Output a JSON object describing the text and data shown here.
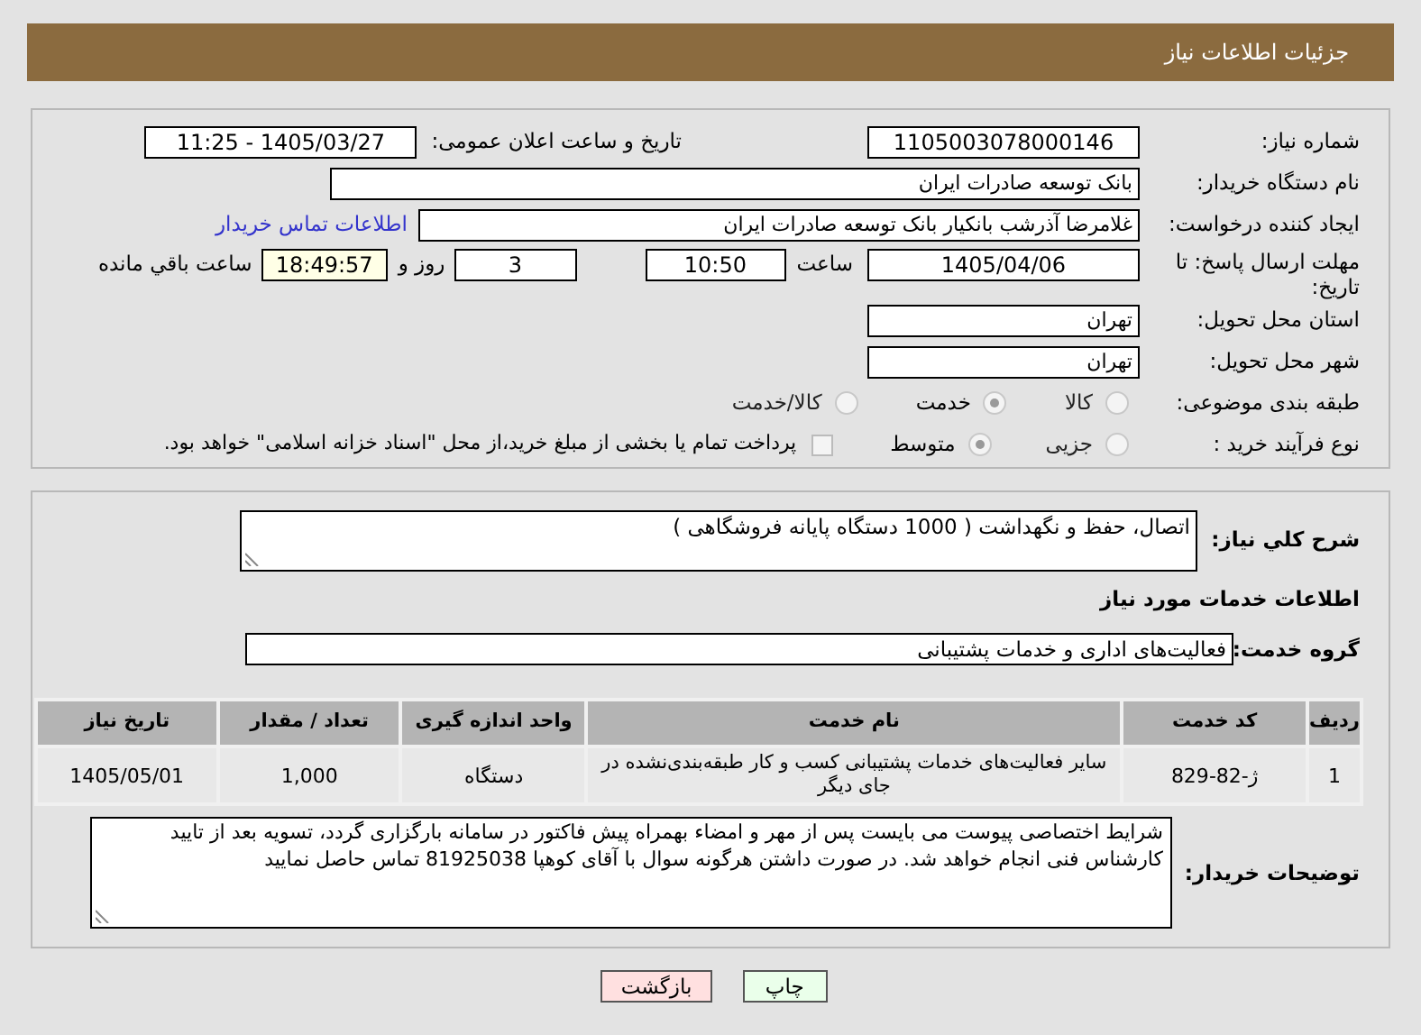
{
  "title": "جزئیات اطلاعات نیاز",
  "need_number": {
    "label": "شماره نیاز:",
    "value": "1105003078000146"
  },
  "announce": {
    "label": "تاریخ و ساعت اعلان عمومی:",
    "value": "1405/03/27 - 11:25"
  },
  "buyer": {
    "label": "نام دستگاه خریدار:",
    "value": "بانک توسعه صادرات ایران"
  },
  "creator": {
    "label": "ایجاد کننده درخواست:",
    "value": "غلامرضا آذرشب بانکیار بانک توسعه صادرات ایران",
    "link": "اطلاعات تماس خریدار"
  },
  "deadline": {
    "label": "مهلت ارسال پاسخ: تا تاریخ:",
    "date": "1405/04/06",
    "time_label": "ساعت",
    "time": "10:50",
    "days": "3",
    "days_label": "روز و",
    "remaining": "18:49:57",
    "remaining_label": "ساعت باقي مانده"
  },
  "province": {
    "label": "استان محل تحویل:",
    "value": "تهران"
  },
  "city": {
    "label": "شهر محل تحویل:",
    "value": "تهران"
  },
  "category": {
    "label": "طبقه بندی موضوعی:",
    "options": [
      {
        "label": "كالا",
        "selected": false
      },
      {
        "label": "خدمت",
        "selected": true
      },
      {
        "label": "كالا/خدمت",
        "selected": false
      }
    ]
  },
  "process": {
    "label": "نوع فرآیند خرید :",
    "options": [
      {
        "label": "جزیی",
        "selected": false
      },
      {
        "label": "متوسط",
        "selected": true
      }
    ],
    "treasury": {
      "label": "پرداخت تمام یا بخشی از مبلغ خرید،از محل \"اسناد خزانه اسلامی\" خواهد بود.",
      "checked": false
    }
  },
  "description": {
    "label": "شرح کلي نیاز:",
    "value": "اتصال، حفظ و نگهداشت  ( 1000 دستگاه پایانه فروشگاهی )"
  },
  "services_heading": "اطلاعات خدمات مورد نیاز",
  "service_group": {
    "label": "گروه خدمت:",
    "value": "فعالیت‌های اداری و خدمات پشتیبانی"
  },
  "table": {
    "columns": [
      "ردیف",
      "کد خدمت",
      "نام خدمت",
      "واحد اندازه گیری",
      "تعداد / مقدار",
      "تاریخ نیاز"
    ],
    "rows": [
      [
        "1",
        "ژ-82-829",
        "سایر فعالیت‌های خدمات پشتیبانی کسب و کار طبقه‌بندی‌نشده در جای دیگر",
        "دستگاه",
        "1,000",
        "1405/05/01"
      ]
    ]
  },
  "buyer_notes": {
    "label": "توضیحات خریدار:",
    "value": "شرایط اختصاصی پیوست می بایست پس از مهر و امضاء بهمراه پیش فاکتور در سامانه بارگزاری گردد، تسویه بعد از تایید کارشناس فنی انجام خواهد شد. در صورت داشتن هرگونه سوال با آقای کوهپا 81925038 تماس حاصل نمایید"
  },
  "buttons": [
    {
      "label": "چاپ",
      "kind": "print"
    },
    {
      "label": "بازگشت",
      "kind": "back"
    }
  ]
}
